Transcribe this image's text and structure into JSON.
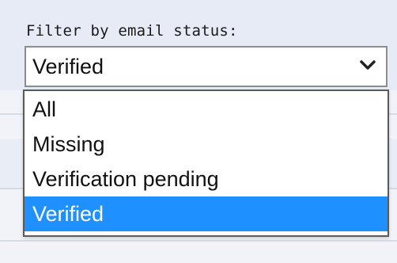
{
  "filter": {
    "label": "Filter by email status:",
    "selected_value": "Verified",
    "options": [
      "All",
      "Missing",
      "Verification pending",
      "Verified"
    ],
    "highlighted_index": 3
  },
  "colors": {
    "highlight": "#1e90ff",
    "highlight_text": "#ffffff",
    "background": "#e6ebf5"
  },
  "icons": {
    "dropdown": "chevron-down-icon"
  }
}
